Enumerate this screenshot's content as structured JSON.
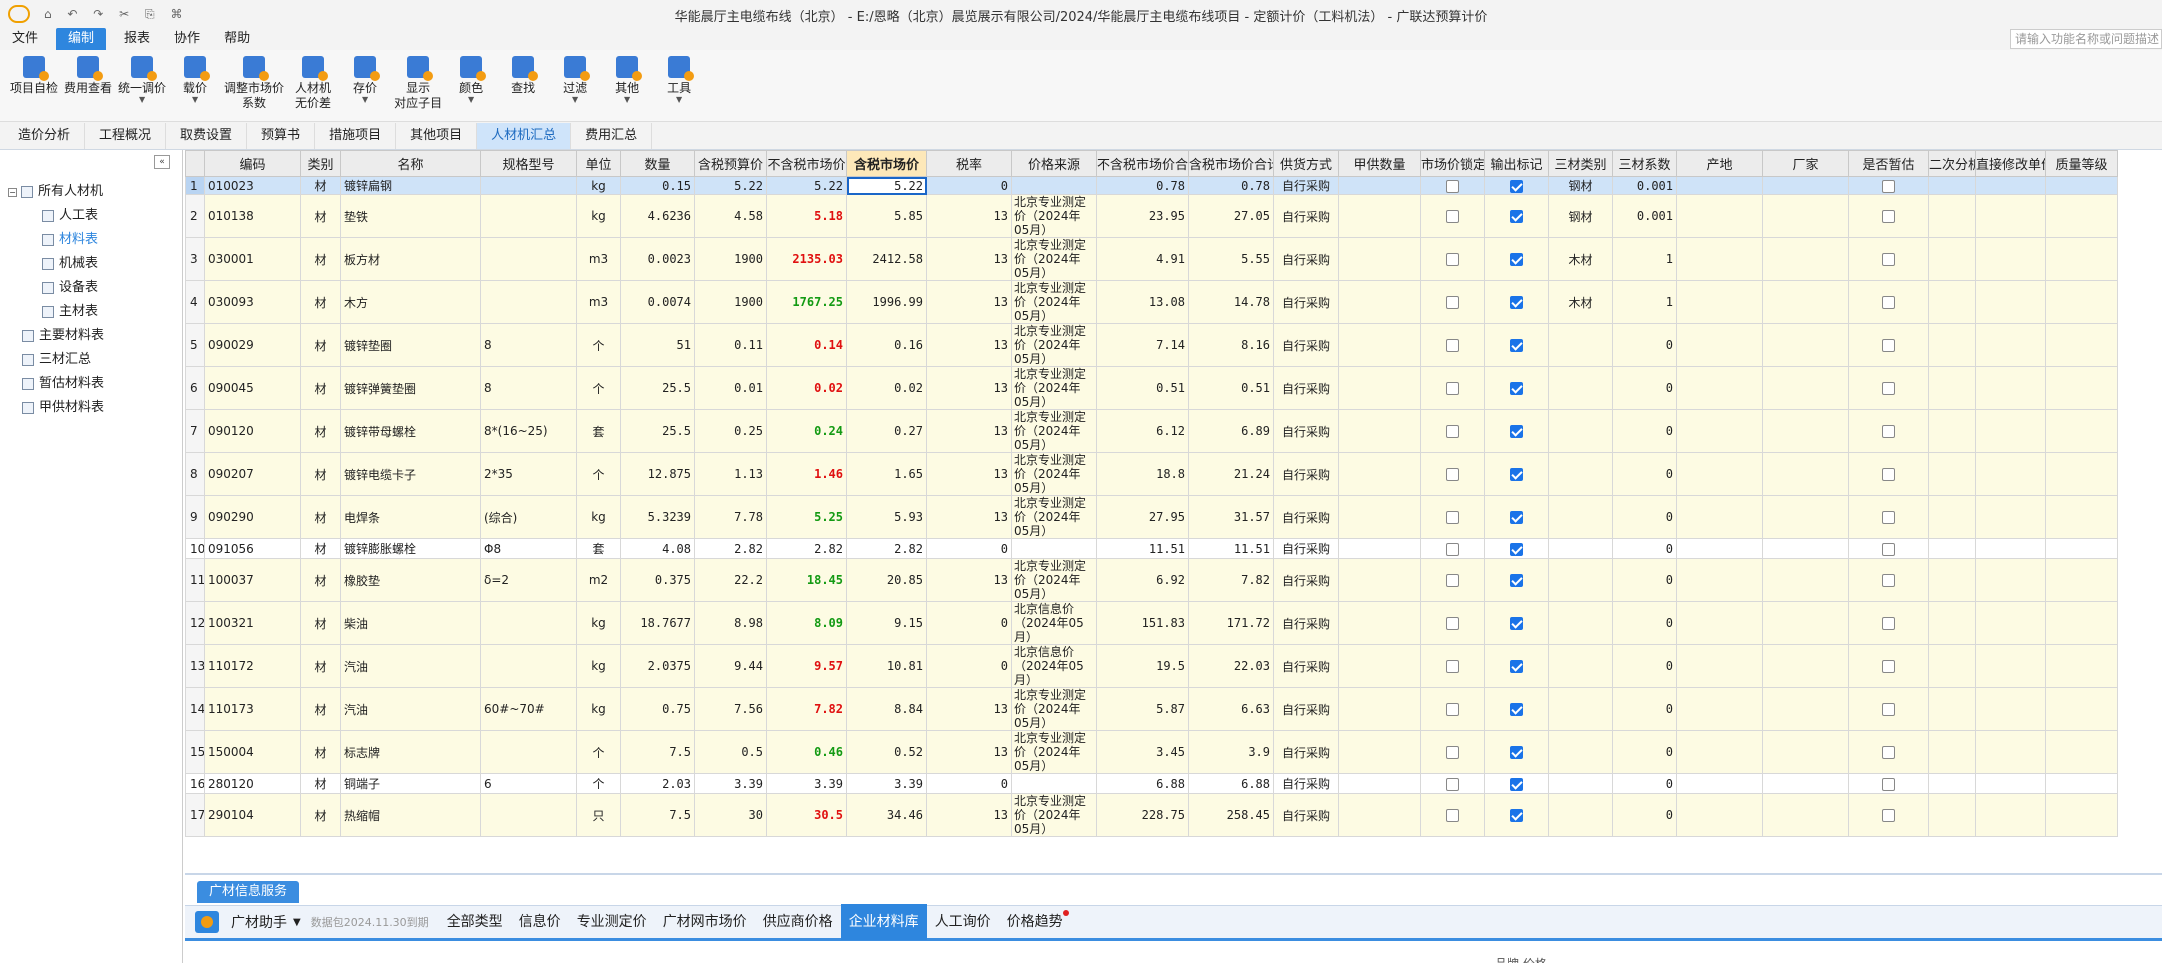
{
  "titlebar": {
    "title": "华能晨厅主电缆布线（北京） - E:/恩略（北京）晨览展示有限公司/2024/华能晨厅主电缆布线项目 - 定额计价（工料机法） - 广联达预算计价",
    "quick_access": "⌂ ↶ ↷ ✂ ⎘ ⌘"
  },
  "menu": {
    "items": [
      "文件",
      "编制",
      "报表",
      "协作",
      "帮助"
    ],
    "active_index": 1,
    "search_placeholder": "请输入功能名称或问题描述"
  },
  "toolbar": {
    "tools": [
      {
        "label": "项目自检",
        "caret": false
      },
      {
        "label": "费用查看",
        "caret": false
      },
      {
        "label": "统一调价",
        "caret": true
      },
      {
        "label": "载价",
        "caret": true
      },
      {
        "label": "调整市场价\n系数",
        "caret": false
      },
      {
        "label": "人材机\n无价差",
        "caret": false
      },
      {
        "label": "存价",
        "caret": true
      },
      {
        "label": "显示\n对应子目",
        "caret": false
      },
      {
        "label": "颜色",
        "caret": true
      },
      {
        "label": "查找",
        "caret": false
      },
      {
        "label": "过滤",
        "caret": true
      },
      {
        "label": "其他",
        "caret": true
      },
      {
        "label": "工具",
        "caret": true
      }
    ]
  },
  "tabs": {
    "items": [
      "造价分析",
      "工程概况",
      "取费设置",
      "预算书",
      "措施项目",
      "其他项目",
      "人材机汇总",
      "费用汇总"
    ],
    "active_index": 6
  },
  "tree": {
    "root": "所有人材机",
    "children": [
      "人工表",
      "材料表",
      "机械表",
      "设备表",
      "主材表"
    ],
    "selected": "材料表",
    "others": [
      "主要材料表",
      "三材汇总",
      "暂估材料表",
      "甲供材料表"
    ]
  },
  "grid": {
    "headers": [
      "编码",
      "类别",
      "名称",
      "规格型号",
      "单位",
      "数量",
      "含税预算价",
      "不含税市场价",
      "含税市场价",
      "税率",
      "价格来源",
      "不含税市场价合计",
      "含税市场价合计",
      "供货方式",
      "甲供数量",
      "市场价锁定",
      "输出标记",
      "三材类别",
      "三材系数",
      "产地",
      "厂家",
      "是否暂估",
      "二次分析",
      "直接修改单价",
      "质量等级"
    ],
    "rows": [
      {
        "no": "1",
        "code": "010023",
        "type": "材",
        "name": "镀锌扁钢",
        "spec": "",
        "unit": "kg",
        "qty": "0.15",
        "budget": "5.22",
        "mkt_ex": "5.22",
        "mkt_in": "5.22",
        "tax": "0",
        "src": "",
        "sum_ex": "0.78",
        "sum_in": "0.78",
        "supply": "自行采购",
        "lock": false,
        "out": true,
        "cat": "钢材",
        "coef": "0.001",
        "est": false,
        "color": "",
        "plain": false
      },
      {
        "no": "2",
        "code": "010138",
        "type": "材",
        "name": "垫铁",
        "spec": "",
        "unit": "kg",
        "qty": "4.6236",
        "budget": "4.58",
        "mkt_ex": "5.18",
        "mkt_in": "5.85",
        "tax": "13",
        "src": "北京专业测定价（2024年05月）",
        "sum_ex": "23.95",
        "sum_in": "27.05",
        "supply": "自行采购",
        "lock": false,
        "out": true,
        "cat": "钢材",
        "coef": "0.001",
        "est": false,
        "color": "red",
        "plain": false
      },
      {
        "no": "3",
        "code": "030001",
        "type": "材",
        "name": "板方材",
        "spec": "",
        "unit": "m3",
        "qty": "0.0023",
        "budget": "1900",
        "mkt_ex": "2135.03",
        "mkt_in": "2412.58",
        "tax": "13",
        "src": "北京专业测定价（2024年05月）",
        "sum_ex": "4.91",
        "sum_in": "5.55",
        "supply": "自行采购",
        "lock": false,
        "out": true,
        "cat": "木材",
        "coef": "1",
        "est": false,
        "color": "red",
        "plain": false
      },
      {
        "no": "4",
        "code": "030093",
        "type": "材",
        "name": "木方",
        "spec": "",
        "unit": "m3",
        "qty": "0.0074",
        "budget": "1900",
        "mkt_ex": "1767.25",
        "mkt_in": "1996.99",
        "tax": "13",
        "src": "北京专业测定价（2024年05月）",
        "sum_ex": "13.08",
        "sum_in": "14.78",
        "supply": "自行采购",
        "lock": false,
        "out": true,
        "cat": "木材",
        "coef": "1",
        "est": false,
        "color": "green",
        "plain": false
      },
      {
        "no": "5",
        "code": "090029",
        "type": "材",
        "name": "镀锌垫圈",
        "spec": "8",
        "unit": "个",
        "qty": "51",
        "budget": "0.11",
        "mkt_ex": "0.14",
        "mkt_in": "0.16",
        "tax": "13",
        "src": "北京专业测定价（2024年05月）",
        "sum_ex": "7.14",
        "sum_in": "8.16",
        "supply": "自行采购",
        "lock": false,
        "out": true,
        "cat": "",
        "coef": "0",
        "est": false,
        "color": "red",
        "plain": false
      },
      {
        "no": "6",
        "code": "090045",
        "type": "材",
        "name": "镀锌弹簧垫圈",
        "spec": "8",
        "unit": "个",
        "qty": "25.5",
        "budget": "0.01",
        "mkt_ex": "0.02",
        "mkt_in": "0.02",
        "tax": "13",
        "src": "北京专业测定价（2024年05月）",
        "sum_ex": "0.51",
        "sum_in": "0.51",
        "supply": "自行采购",
        "lock": false,
        "out": true,
        "cat": "",
        "coef": "0",
        "est": false,
        "color": "red",
        "plain": false
      },
      {
        "no": "7",
        "code": "090120",
        "type": "材",
        "name": "镀锌带母螺栓",
        "spec": "8*(16~25)",
        "unit": "套",
        "qty": "25.5",
        "budget": "0.25",
        "mkt_ex": "0.24",
        "mkt_in": "0.27",
        "tax": "13",
        "src": "北京专业测定价（2024年05月）",
        "sum_ex": "6.12",
        "sum_in": "6.89",
        "supply": "自行采购",
        "lock": false,
        "out": true,
        "cat": "",
        "coef": "0",
        "est": false,
        "color": "green",
        "plain": false
      },
      {
        "no": "8",
        "code": "090207",
        "type": "材",
        "name": "镀锌电缆卡子",
        "spec": "2*35",
        "unit": "个",
        "qty": "12.875",
        "budget": "1.13",
        "mkt_ex": "1.46",
        "mkt_in": "1.65",
        "tax": "13",
        "src": "北京专业测定价（2024年05月）",
        "sum_ex": "18.8",
        "sum_in": "21.24",
        "supply": "自行采购",
        "lock": false,
        "out": true,
        "cat": "",
        "coef": "0",
        "est": false,
        "color": "red",
        "plain": false
      },
      {
        "no": "9",
        "code": "090290",
        "type": "材",
        "name": "电焊条",
        "spec": "(综合)",
        "unit": "kg",
        "qty": "5.3239",
        "budget": "7.78",
        "mkt_ex": "5.25",
        "mkt_in": "5.93",
        "tax": "13",
        "src": "北京专业测定价（2024年05月）",
        "sum_ex": "27.95",
        "sum_in": "31.57",
        "supply": "自行采购",
        "lock": false,
        "out": true,
        "cat": "",
        "coef": "0",
        "est": false,
        "color": "green",
        "plain": false
      },
      {
        "no": "10",
        "code": "091056",
        "type": "材",
        "name": "镀锌膨胀螺栓",
        "spec": "Φ8",
        "unit": "套",
        "qty": "4.08",
        "budget": "2.82",
        "mkt_ex": "2.82",
        "mkt_in": "2.82",
        "tax": "0",
        "src": "",
        "sum_ex": "11.51",
        "sum_in": "11.51",
        "supply": "自行采购",
        "lock": false,
        "out": true,
        "cat": "",
        "coef": "0",
        "est": false,
        "color": "",
        "plain": true
      },
      {
        "no": "11",
        "code": "100037",
        "type": "材",
        "name": "橡胶垫",
        "spec": "δ=2",
        "unit": "m2",
        "qty": "0.375",
        "budget": "22.2",
        "mkt_ex": "18.45",
        "mkt_in": "20.85",
        "tax": "13",
        "src": "北京专业测定价（2024年05月）",
        "sum_ex": "6.92",
        "sum_in": "7.82",
        "supply": "自行采购",
        "lock": false,
        "out": true,
        "cat": "",
        "coef": "0",
        "est": false,
        "color": "green",
        "plain": false
      },
      {
        "no": "12",
        "code": "100321",
        "type": "材",
        "name": "柴油",
        "spec": "",
        "unit": "kg",
        "qty": "18.7677",
        "budget": "8.98",
        "mkt_ex": "8.09",
        "mkt_in": "9.15",
        "tax": "0",
        "src": "北京信息价（2024年05月）",
        "sum_ex": "151.83",
        "sum_in": "171.72",
        "supply": "自行采购",
        "lock": false,
        "out": true,
        "cat": "",
        "coef": "0",
        "est": false,
        "color": "green",
        "plain": false
      },
      {
        "no": "13",
        "code": "110172",
        "type": "材",
        "name": "汽油",
        "spec": "",
        "unit": "kg",
        "qty": "2.0375",
        "budget": "9.44",
        "mkt_ex": "9.57",
        "mkt_in": "10.81",
        "tax": "0",
        "src": "北京信息价（2024年05月）",
        "sum_ex": "19.5",
        "sum_in": "22.03",
        "supply": "自行采购",
        "lock": false,
        "out": true,
        "cat": "",
        "coef": "0",
        "est": false,
        "color": "red",
        "plain": false
      },
      {
        "no": "14",
        "code": "110173",
        "type": "材",
        "name": "汽油",
        "spec": "60#~70#",
        "unit": "kg",
        "qty": "0.75",
        "budget": "7.56",
        "mkt_ex": "7.82",
        "mkt_in": "8.84",
        "tax": "13",
        "src": "北京专业测定价（2024年05月）",
        "sum_ex": "5.87",
        "sum_in": "6.63",
        "supply": "自行采购",
        "lock": false,
        "out": true,
        "cat": "",
        "coef": "0",
        "est": false,
        "color": "red",
        "plain": false
      },
      {
        "no": "15",
        "code": "150004",
        "type": "材",
        "name": "标志牌",
        "spec": "",
        "unit": "个",
        "qty": "7.5",
        "budget": "0.5",
        "mkt_ex": "0.46",
        "mkt_in": "0.52",
        "tax": "13",
        "src": "北京专业测定价（2024年05月）",
        "sum_ex": "3.45",
        "sum_in": "3.9",
        "supply": "自行采购",
        "lock": false,
        "out": true,
        "cat": "",
        "coef": "0",
        "est": false,
        "color": "green",
        "plain": false
      },
      {
        "no": "16",
        "code": "280120",
        "type": "材",
        "name": "铜端子",
        "spec": "6",
        "unit": "个",
        "qty": "2.03",
        "budget": "3.39",
        "mkt_ex": "3.39",
        "mkt_in": "3.39",
        "tax": "0",
        "src": "",
        "sum_ex": "6.88",
        "sum_in": "6.88",
        "supply": "自行采购",
        "lock": false,
        "out": true,
        "cat": "",
        "coef": "0",
        "est": false,
        "color": "",
        "plain": true
      },
      {
        "no": "17",
        "code": "290104",
        "type": "材",
        "name": "热缩帽",
        "spec": "",
        "unit": "只",
        "qty": "7.5",
        "budget": "30",
        "mkt_ex": "30.5",
        "mkt_in": "34.46",
        "tax": "13",
        "src": "北京专业测定价（2024年05月）",
        "sum_ex": "228.75",
        "sum_in": "258.45",
        "supply": "自行采购",
        "lock": false,
        "out": true,
        "cat": "",
        "coef": "0",
        "est": false,
        "color": "red",
        "plain": false
      }
    ]
  },
  "bottom": {
    "tab": "广材信息服务",
    "assistant": "广材助手",
    "note": "数据包2024.11.30到期",
    "links": [
      "全部类型",
      "信息价",
      "专业测定价",
      "广材网市场价",
      "供应商价格",
      "企业材料库",
      "人工询价",
      "价格趋势"
    ],
    "active_index": 5,
    "dot_index": 7,
    "footer": "品牌 价格"
  }
}
